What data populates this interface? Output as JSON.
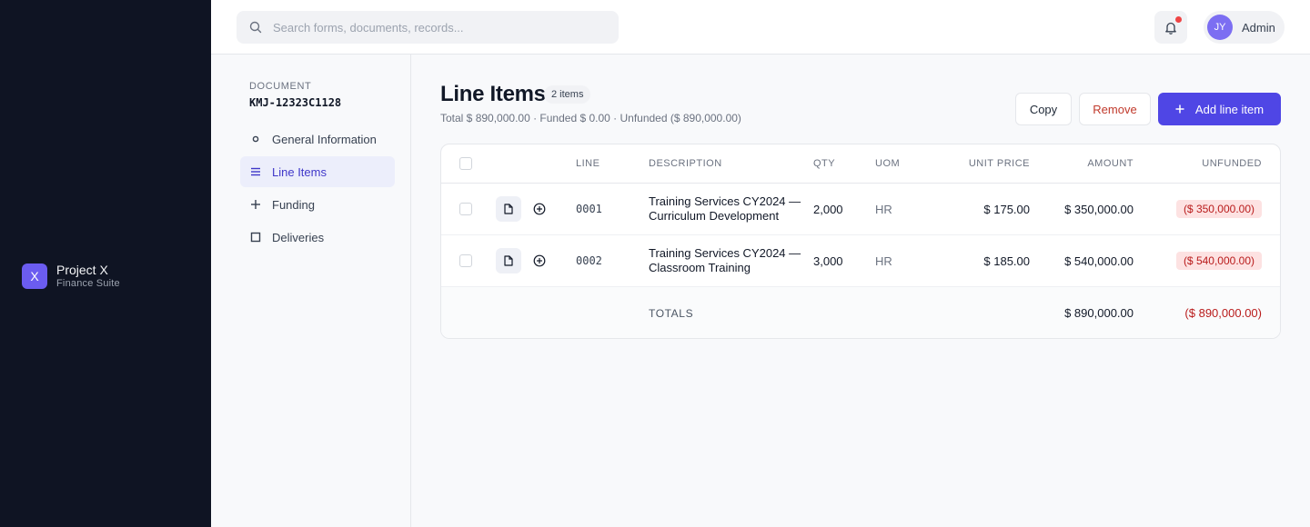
{
  "brand": {
    "logo_letter": "X",
    "name": "Project X",
    "subtitle": "Finance Suite"
  },
  "topbar": {
    "search_placeholder": "Search forms, documents, records...",
    "user_initials": "JY",
    "user_name": "Admin",
    "has_notification": true
  },
  "subnav": {
    "doc_label": "DOCUMENT",
    "doc_id": "KMJ-12323C1128",
    "items": [
      {
        "label": "General Information",
        "icon": "circle-icon",
        "active": false
      },
      {
        "label": "Line Items",
        "icon": "list-icon",
        "active": true
      },
      {
        "label": "Funding",
        "icon": "plus-icon",
        "active": false
      },
      {
        "label": "Deliveries",
        "icon": "square-icon",
        "active": false
      }
    ]
  },
  "main": {
    "title": "Line Items",
    "count_badge": "2 items",
    "summary": "Total $ 890,000.00 · Funded $ 0.00 · Unfunded ($ 890,000.00)",
    "buttons": {
      "copy": "Copy",
      "remove": "Remove",
      "add": "Add line item"
    }
  },
  "table": {
    "columns": [
      "LINE",
      "DESCRIPTION",
      "QTY",
      "UOM",
      "UNIT PRICE",
      "AMOUNT",
      "UNFUNDED"
    ],
    "rows": [
      {
        "line": "0001",
        "description": "Training Services CY2024 — Curriculum Development",
        "qty": "2,000",
        "uom": "HR",
        "unit_price": "$ 175.00",
        "amount": "$ 350,000.00",
        "unfunded": "($ 350,000.00)"
      },
      {
        "line": "0002",
        "description": "Training Services CY2024 — Classroom Training",
        "qty": "3,000",
        "uom": "HR",
        "unit_price": "$ 185.00",
        "amount": "$ 540,000.00",
        "unfunded": "($ 540,000.00)"
      }
    ],
    "totals": {
      "label": "TOTALS",
      "amount": "$ 890,000.00",
      "unfunded": "($ 890,000.00)"
    }
  },
  "colors": {
    "accent": "#4f46e5",
    "sidebar": "#0f1423",
    "danger": "#b91c1c",
    "brand": "#6b5cf0"
  }
}
